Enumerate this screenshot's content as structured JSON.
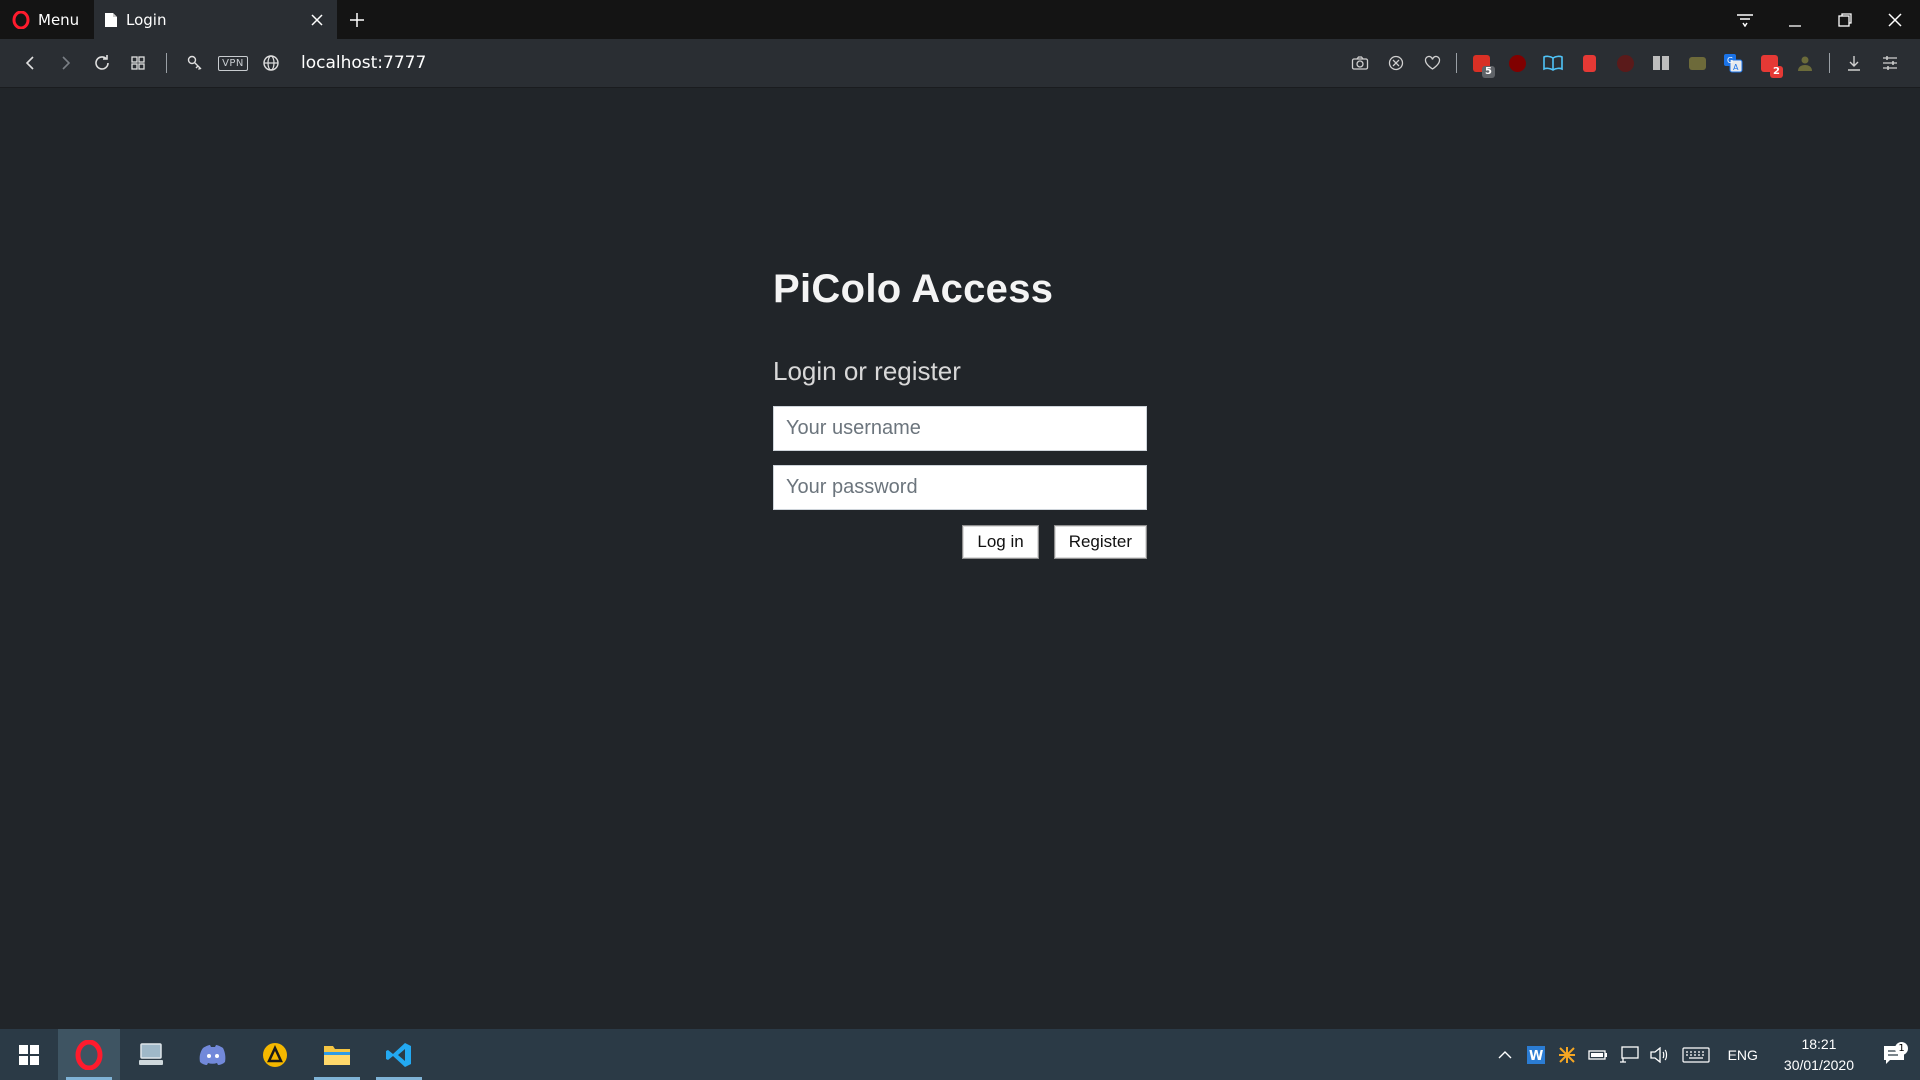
{
  "browser": {
    "menu_label": "Menu",
    "tab_title": "Login",
    "url": "localhost:7777",
    "vpn_label": "VPN",
    "extensions": [
      {
        "name": "mail-extension-icon",
        "color": "#d93025",
        "badge": "5",
        "badge_color": "#5f6368"
      },
      {
        "name": "ublock-icon",
        "color": "#800000",
        "badge": "",
        "badge_color": ""
      },
      {
        "name": "reader-icon",
        "color": "#4fc3f7",
        "badge": "",
        "badge_color": ""
      },
      {
        "name": "bookmark-red-icon",
        "color": "#e53935",
        "badge": "",
        "badge_color": ""
      },
      {
        "name": "dark-reader-icon",
        "color": "#5a1a1a",
        "badge": "",
        "badge_color": ""
      },
      {
        "name": "book-icon",
        "color": "#bdbdbd",
        "badge": "",
        "badge_color": ""
      },
      {
        "name": "chat-icon",
        "color": "#6d6a3a",
        "badge": "",
        "badge_color": ""
      },
      {
        "name": "translate-icon",
        "color": "#1a73e8",
        "badge": "",
        "badge_color": ""
      },
      {
        "name": "todo-icon",
        "color": "#e53935",
        "badge": "2",
        "badge_color": "#e53935"
      },
      {
        "name": "profile-icon",
        "color": "#6b6b3a",
        "badge": "",
        "badge_color": ""
      }
    ]
  },
  "page": {
    "title": "PiColo Access",
    "subtitle": "Login or register",
    "username_placeholder": "Your username",
    "password_placeholder": "Your password",
    "login_label": "Log in",
    "register_label": "Register"
  },
  "taskbar": {
    "apps": [
      "opera-browser-icon",
      "remote-desktop-icon",
      "discord-icon",
      "arch-app-icon",
      "file-explorer-icon",
      "vscode-icon"
    ],
    "language": "ENG",
    "time": "18:21",
    "date": "30/01/2020",
    "notification_count": "1"
  },
  "colors": {
    "page_bg": "#212529",
    "titlebar_bg": "#141414",
    "toolbar_bg": "#2a2e33",
    "taskbar_bg": "#2b3a46",
    "opera_red": "#ff1b2d"
  }
}
